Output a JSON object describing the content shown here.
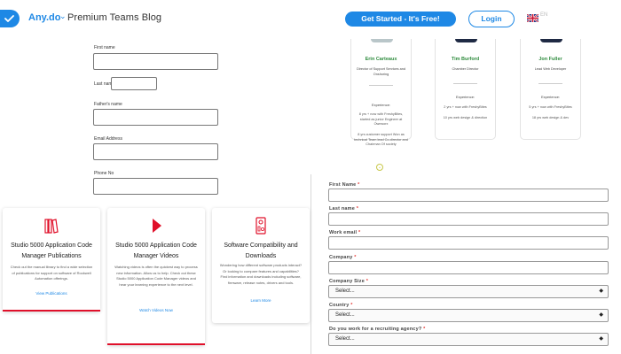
{
  "header": {
    "brand": "Any.do",
    "title": "Premium Teams Blog",
    "cta_button": "Get Started - It's Free!",
    "login_button": "Login",
    "language_code": "EN"
  },
  "left_form": {
    "first_name_label": "First name",
    "last_name_label": "Last name",
    "fathers_name_label": "Father's name",
    "email_label": "Email Address",
    "phone_label": "Phone No"
  },
  "cards": [
    {
      "title": "Studio 5000 Application Code Manager Publications",
      "description": "Check out the manual library to find a wide selection of publications for support on software of Rockwell Automation offerings.",
      "link": "View Publications",
      "icon": "books-icon"
    },
    {
      "title": "Studio 5000 Application Code Manager Videos",
      "description": "Watching videos is often the quickest way to process new information. Allow us to help. Check out these Studio 5000 Application Code Manager videos and hear your learning experience to the next level.",
      "link": "Watch Videos Now",
      "icon": "play-icon"
    },
    {
      "title": "Software Compatibility and Downloads",
      "description": "Wondering how different software products interact? Or looking to compare features and capabilities? Find information and downloads including software, firmware, release notes, drivers and tools.",
      "link": "Learn More",
      "icon": "download-device-icon"
    }
  ],
  "team": [
    {
      "name": "Erin Carteaux",
      "role": "Director of Support Services and Onshoring",
      "experience_label": "Experience:",
      "lines": [
        "8 yrs + now with FreshyBites, started as junior Engineer at Ownworx",
        "8 yrs customer support Won as technical Team lead Co-director and Chairman Of society"
      ]
    },
    {
      "name": "Tim Burford",
      "role": "Chamber Director",
      "experience_label": "Experience:",
      "lines": [
        "2 yrs + now with FreshyBites",
        "10 yrs web design & direction"
      ]
    },
    {
      "name": "Jon Fuller",
      "role": "Lead Web Developer",
      "experience_label": "Experience:",
      "lines": [
        "5 yrs + now with FreshyBites",
        "18 yrs web design & dev"
      ]
    }
  ],
  "right_form": {
    "first_name_label": "First Name",
    "last_name_label": "Last name",
    "work_email_label": "Work email",
    "company_label": "Company",
    "company_size_label": "Company Size",
    "country_label": "Country",
    "recruiting_label": "Do you work for a recruiting agency?",
    "select_placeholder": "Select...",
    "required_mark": "*"
  },
  "colors": {
    "accent": "#1e88e5",
    "card_red": "#e0102a",
    "team_name_green": "#2e8b3d"
  }
}
